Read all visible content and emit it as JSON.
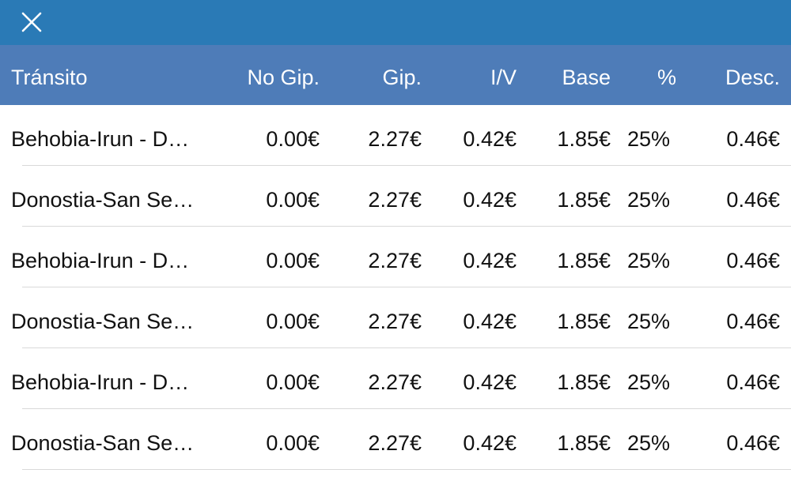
{
  "topbar": {
    "close_icon": "close-icon",
    "color": "#2a7ab6"
  },
  "header": {
    "color": "#4e7cb8",
    "columns": {
      "name": "Tránsito",
      "nogip": "No Gip.",
      "gip": "Gip.",
      "iv": "I/V",
      "base": "Base",
      "pct": "%",
      "desc": "Desc."
    }
  },
  "rows": [
    {
      "name": "Behobia-Irun - D…",
      "nogip": "0.00€",
      "gip": "2.27€",
      "iv": "0.42€",
      "base": "1.85€",
      "pct": "25%",
      "desc": "0.46€"
    },
    {
      "name": "Donostia-San Se…",
      "nogip": "0.00€",
      "gip": "2.27€",
      "iv": "0.42€",
      "base": "1.85€",
      "pct": "25%",
      "desc": "0.46€"
    },
    {
      "name": "Behobia-Irun - D…",
      "nogip": "0.00€",
      "gip": "2.27€",
      "iv": "0.42€",
      "base": "1.85€",
      "pct": "25%",
      "desc": "0.46€"
    },
    {
      "name": "Donostia-San Se…",
      "nogip": "0.00€",
      "gip": "2.27€",
      "iv": "0.42€",
      "base": "1.85€",
      "pct": "25%",
      "desc": "0.46€"
    },
    {
      "name": "Behobia-Irun - D…",
      "nogip": "0.00€",
      "gip": "2.27€",
      "iv": "0.42€",
      "base": "1.85€",
      "pct": "25%",
      "desc": "0.46€"
    },
    {
      "name": "Donostia-San Se…",
      "nogip": "0.00€",
      "gip": "2.27€",
      "iv": "0.42€",
      "base": "1.85€",
      "pct": "25%",
      "desc": "0.46€"
    }
  ]
}
